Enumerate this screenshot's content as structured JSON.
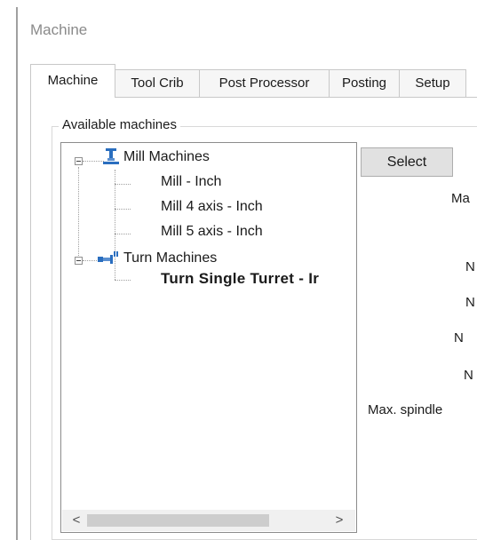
{
  "window": {
    "title": "Machine"
  },
  "tabs": [
    {
      "label": "Machine",
      "active": true
    },
    {
      "label": "Tool Crib",
      "active": false
    },
    {
      "label": "Post Processor",
      "active": false
    },
    {
      "label": "Posting",
      "active": false
    },
    {
      "label": "Setup",
      "active": false
    }
  ],
  "available_machines": {
    "group_label": "Available machines",
    "tree": [
      {
        "label": "Mill Machines",
        "icon": "mill-machine-icon",
        "expanded": true,
        "children": [
          {
            "label": "Mill - Inch"
          },
          {
            "label": "Mill 4 axis - Inch"
          },
          {
            "label": "Mill 5 axis - Inch"
          }
        ]
      },
      {
        "label": "Turn Machines",
        "icon": "turn-machine-icon",
        "expanded": true,
        "children": [
          {
            "label": "Turn Single Turret - Ir",
            "selected_bold": true
          }
        ]
      }
    ],
    "scroll_left_glyph": "<",
    "scroll_right_glyph": ">"
  },
  "select_button": {
    "label": "Select"
  },
  "properties_labels": [
    "Ma",
    "N",
    "N",
    "N",
    "N",
    "Max. spindle"
  ],
  "colors": {
    "button_face": "#e1e1e1",
    "border": "#c8c8c8",
    "title_text": "#8a8a8a"
  }
}
